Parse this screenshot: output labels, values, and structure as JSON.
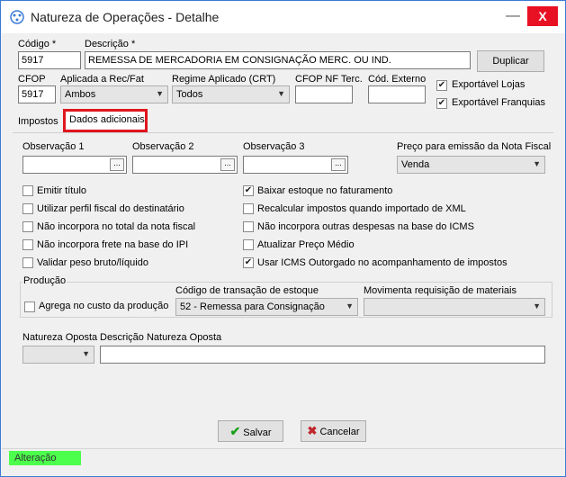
{
  "window": {
    "title": "Natureza de Operações - Detalhe",
    "close_label": "X",
    "minimize_label": "—"
  },
  "form": {
    "codigo_label": "Código *",
    "codigo_value": "5917",
    "descricao_label": "Descrição *",
    "descricao_value": "REMESSA DE MERCADORIA EM CONSIGNAÇÃO MERC. OU IND.",
    "duplicar_label": "Duplicar",
    "cfop_label": "CFOP",
    "cfop_value": "5917",
    "aplicada_label": "Aplicada a Rec/Fat",
    "aplicada_value": "Ambos",
    "regime_label": "Regime Aplicado (CRT)",
    "regime_value": "Todos",
    "cfop_nf_label": "CFOP NF Terc.",
    "cfop_nf_value": "",
    "cod_externo_label": "Cód. Externo",
    "cod_externo_value": "",
    "exportavel_lojas_label": "Exportável Lojas",
    "exportavel_lojas_checked": true,
    "exportavel_franquias_label": "Exportável Franquias",
    "exportavel_franquias_checked": true
  },
  "tabs": [
    {
      "label": "Impostos"
    },
    {
      "label": "Dados adicionais"
    }
  ],
  "dados": {
    "obs1_label": "Observação 1",
    "obs2_label": "Observação 2",
    "obs3_label": "Observação 3",
    "ellipsis": "...",
    "preco_label": "Preço para emissão da Nota Fiscal",
    "preco_value": "Venda",
    "checks_left": [
      {
        "label": "Emitir título",
        "checked": false
      },
      {
        "label": "Utilizar perfil fiscal do destinatário",
        "checked": false
      },
      {
        "label": "Não incorpora no total da nota fiscal",
        "checked": false
      },
      {
        "label": "Não incorpora frete na base do IPI",
        "checked": false
      },
      {
        "label": "Validar peso bruto/líquido",
        "checked": false
      }
    ],
    "checks_right": [
      {
        "label": "Baixar estoque no faturamento",
        "checked": true
      },
      {
        "label": "Recalcular impostos quando importado de XML",
        "checked": false
      },
      {
        "label": "Não incorpora outras despesas na base do ICMS",
        "checked": false
      },
      {
        "label": "Atualizar Preço Médio",
        "checked": false
      },
      {
        "label": "Usar ICMS Outorgado no acompanhamento de impostos",
        "checked": true
      }
    ],
    "producao_label": "Produção",
    "agrega_label": "Agrega no custo da produção",
    "agrega_checked": false,
    "codigo_transacao_label": "Código de transação de estoque",
    "codigo_transacao_value": "52 - Remessa para Consignação",
    "movimenta_label": "Movimenta requisição de materiais",
    "movimenta_value": "",
    "natureza_oposta_label": "Natureza Oposta",
    "natureza_oposta_value": "",
    "descricao_oposta_label": "Descrição Natureza Oposta",
    "descricao_oposta_value": ""
  },
  "buttons": {
    "salvar_label": "Salvar",
    "cancelar_label": "Cancelar"
  },
  "status": {
    "label": "Alteração",
    "color": "#4cff4c"
  },
  "colors": {
    "accent_red": "#e0161e",
    "check_green": "#1aa01a",
    "cancel_red": "#c0262d"
  }
}
